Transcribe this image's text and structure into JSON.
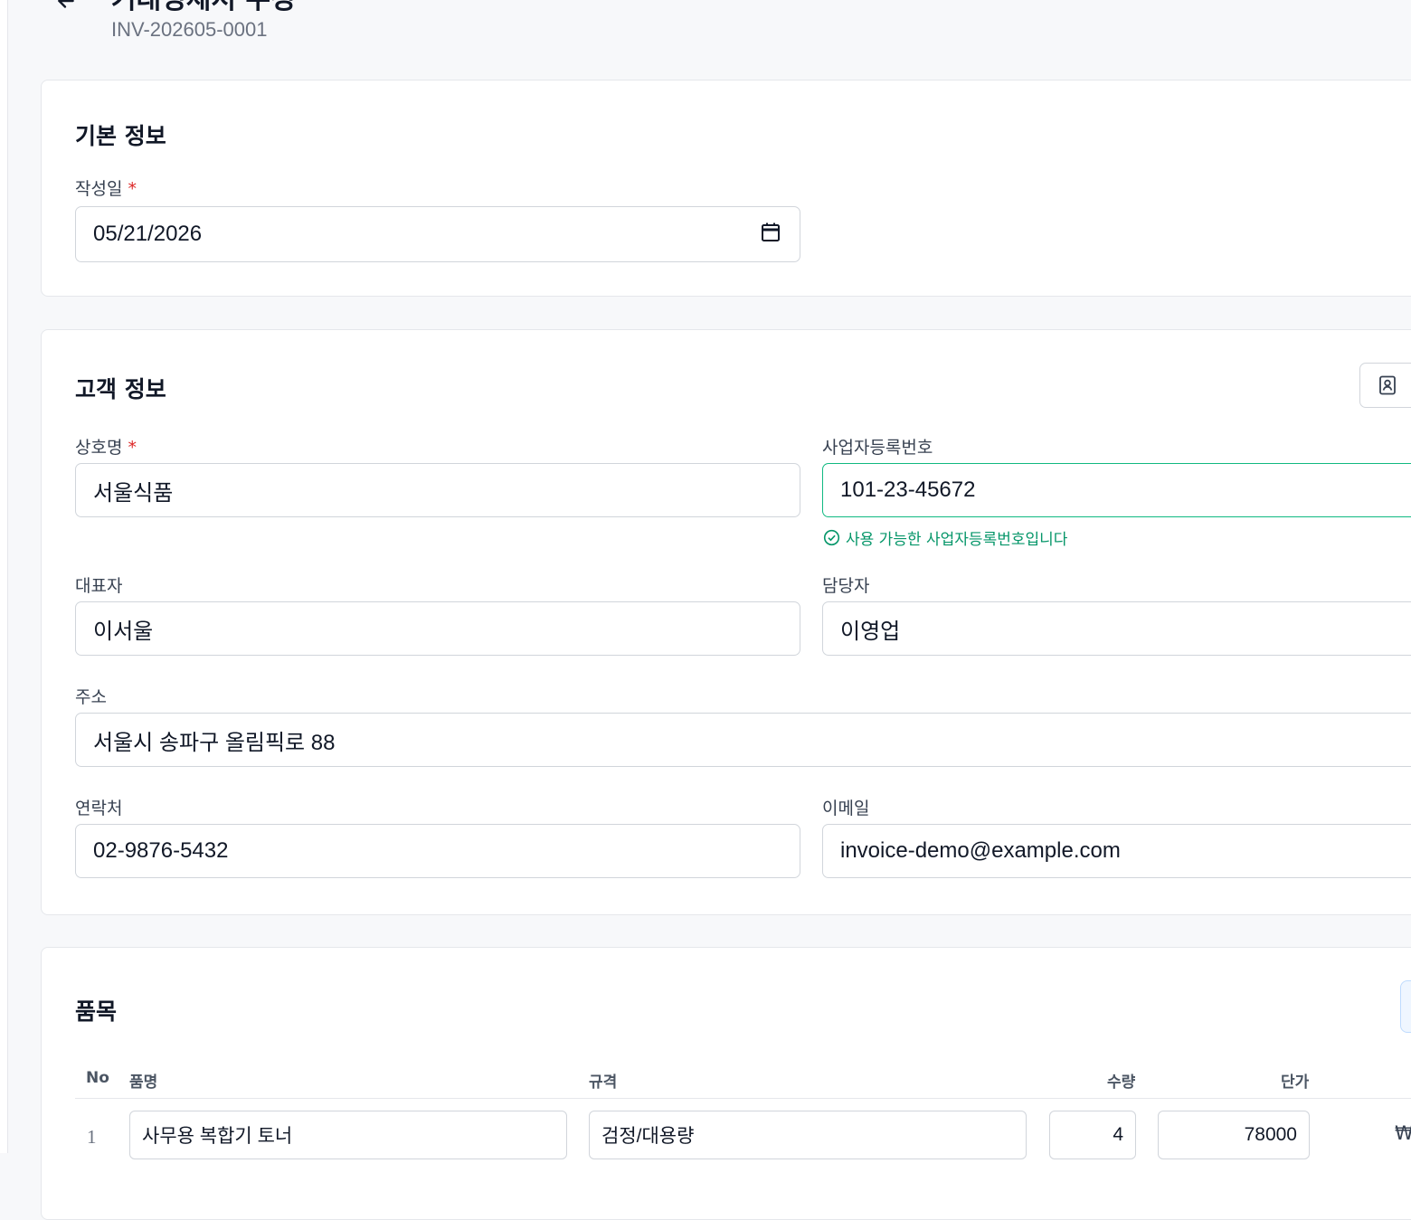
{
  "header": {
    "title": "거래명세서 수정",
    "invoice_no": "INV-202605-0001"
  },
  "basic_info": {
    "title": "기본 정보",
    "date_label": "작성일",
    "required_mark": "*",
    "date_value": "05/21/2026"
  },
  "customer_info": {
    "title": "고객 정보",
    "company_label": "상호명",
    "company_value": "서울식품",
    "biz_no_label": "사업자등록번호",
    "biz_no_value": "101-23-45672",
    "biz_no_hint": "사용 가능한 사업자등록번호입니다",
    "ceo_label": "대표자",
    "ceo_value": "이서울",
    "manager_label": "담당자",
    "manager_value": "이영업",
    "address_label": "주소",
    "address_value": "서울시 송파구 올림픽로 88",
    "phone_label": "연락처",
    "phone_value": "02-9876-5432",
    "email_label": "이메일",
    "email_value": "invoice-demo@example.com"
  },
  "items": {
    "title": "품목",
    "columns": [
      "No",
      "품명",
      "규격",
      "수량",
      "단가"
    ],
    "rows": [
      {
        "no": "1",
        "name": "사무용 복합기 토너",
        "spec": "검정/대용량",
        "qty": "4",
        "price": "78000",
        "amount_prefix": "₩"
      }
    ]
  },
  "colors": {
    "accent_valid": "#10b981",
    "required": "#dc2626"
  },
  "icons": {
    "back": "arrow-left-icon",
    "calendar": "calendar-icon",
    "address_book": "address-book-icon",
    "check": "check-circle-icon"
  }
}
